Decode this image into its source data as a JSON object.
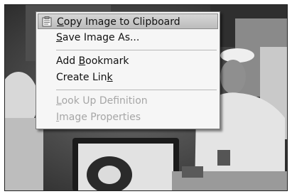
{
  "context_menu": {
    "items": [
      {
        "label": "Copy Image to Clipboard",
        "access_key": "C",
        "rest": "opy Image to Clipboard",
        "icon": "clipboard-icon",
        "state": "highlighted"
      },
      {
        "label": "Save Image As...",
        "access_key": "S",
        "rest": "ave Image As...",
        "state": "enabled"
      },
      {
        "label": "Add Bookmark",
        "lead": "Add ",
        "access_key": "B",
        "rest": "ookmark",
        "state": "enabled"
      },
      {
        "label": "Create Link",
        "lead": "Create Lin",
        "access_key": "k",
        "state": "enabled"
      },
      {
        "label": "Look Up Definition",
        "access_key": "L",
        "rest": "ook Up Definition",
        "state": "disabled"
      },
      {
        "label": "Image Properties",
        "access_key": "I",
        "rest": "mage Properties",
        "state": "disabled"
      }
    ]
  },
  "background": {
    "description_icon": "photo-background"
  }
}
